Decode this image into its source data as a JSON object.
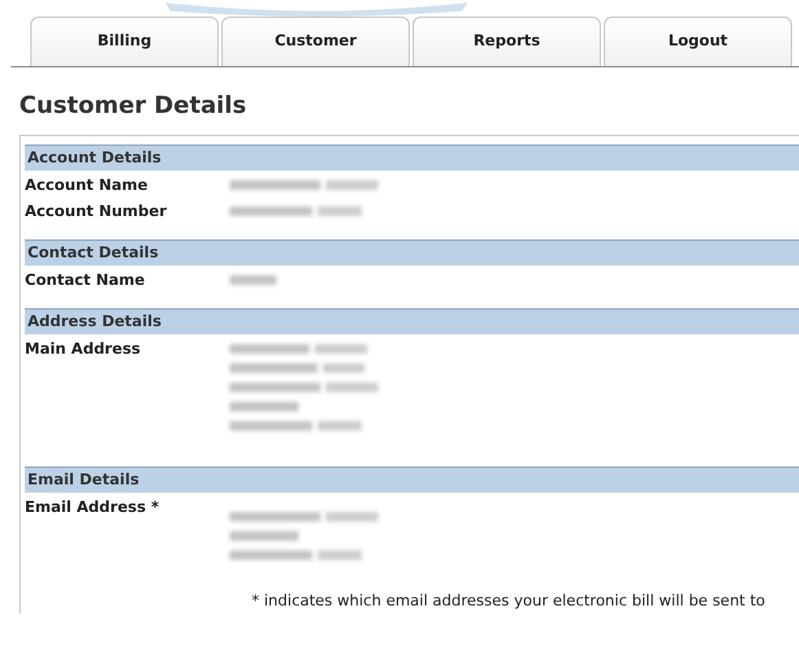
{
  "tabs": [
    {
      "label": "Billing"
    },
    {
      "label": "Customer"
    },
    {
      "label": "Reports"
    },
    {
      "label": "Logout"
    }
  ],
  "heading": "Customer Details",
  "sections": [
    {
      "title": "Account Details",
      "rows": [
        {
          "label": "Account Name"
        },
        {
          "label": "Account Number"
        }
      ]
    },
    {
      "title": "Contact Details",
      "rows": [
        {
          "label": "Contact Name"
        }
      ]
    },
    {
      "title": "Address Details",
      "rows": [
        {
          "label": "Main Address"
        }
      ]
    },
    {
      "title": "Email Details",
      "rows": [
        {
          "label": "Email Address *"
        }
      ]
    }
  ],
  "note": "* indicates which email addresses your electronic bill will be sent to"
}
